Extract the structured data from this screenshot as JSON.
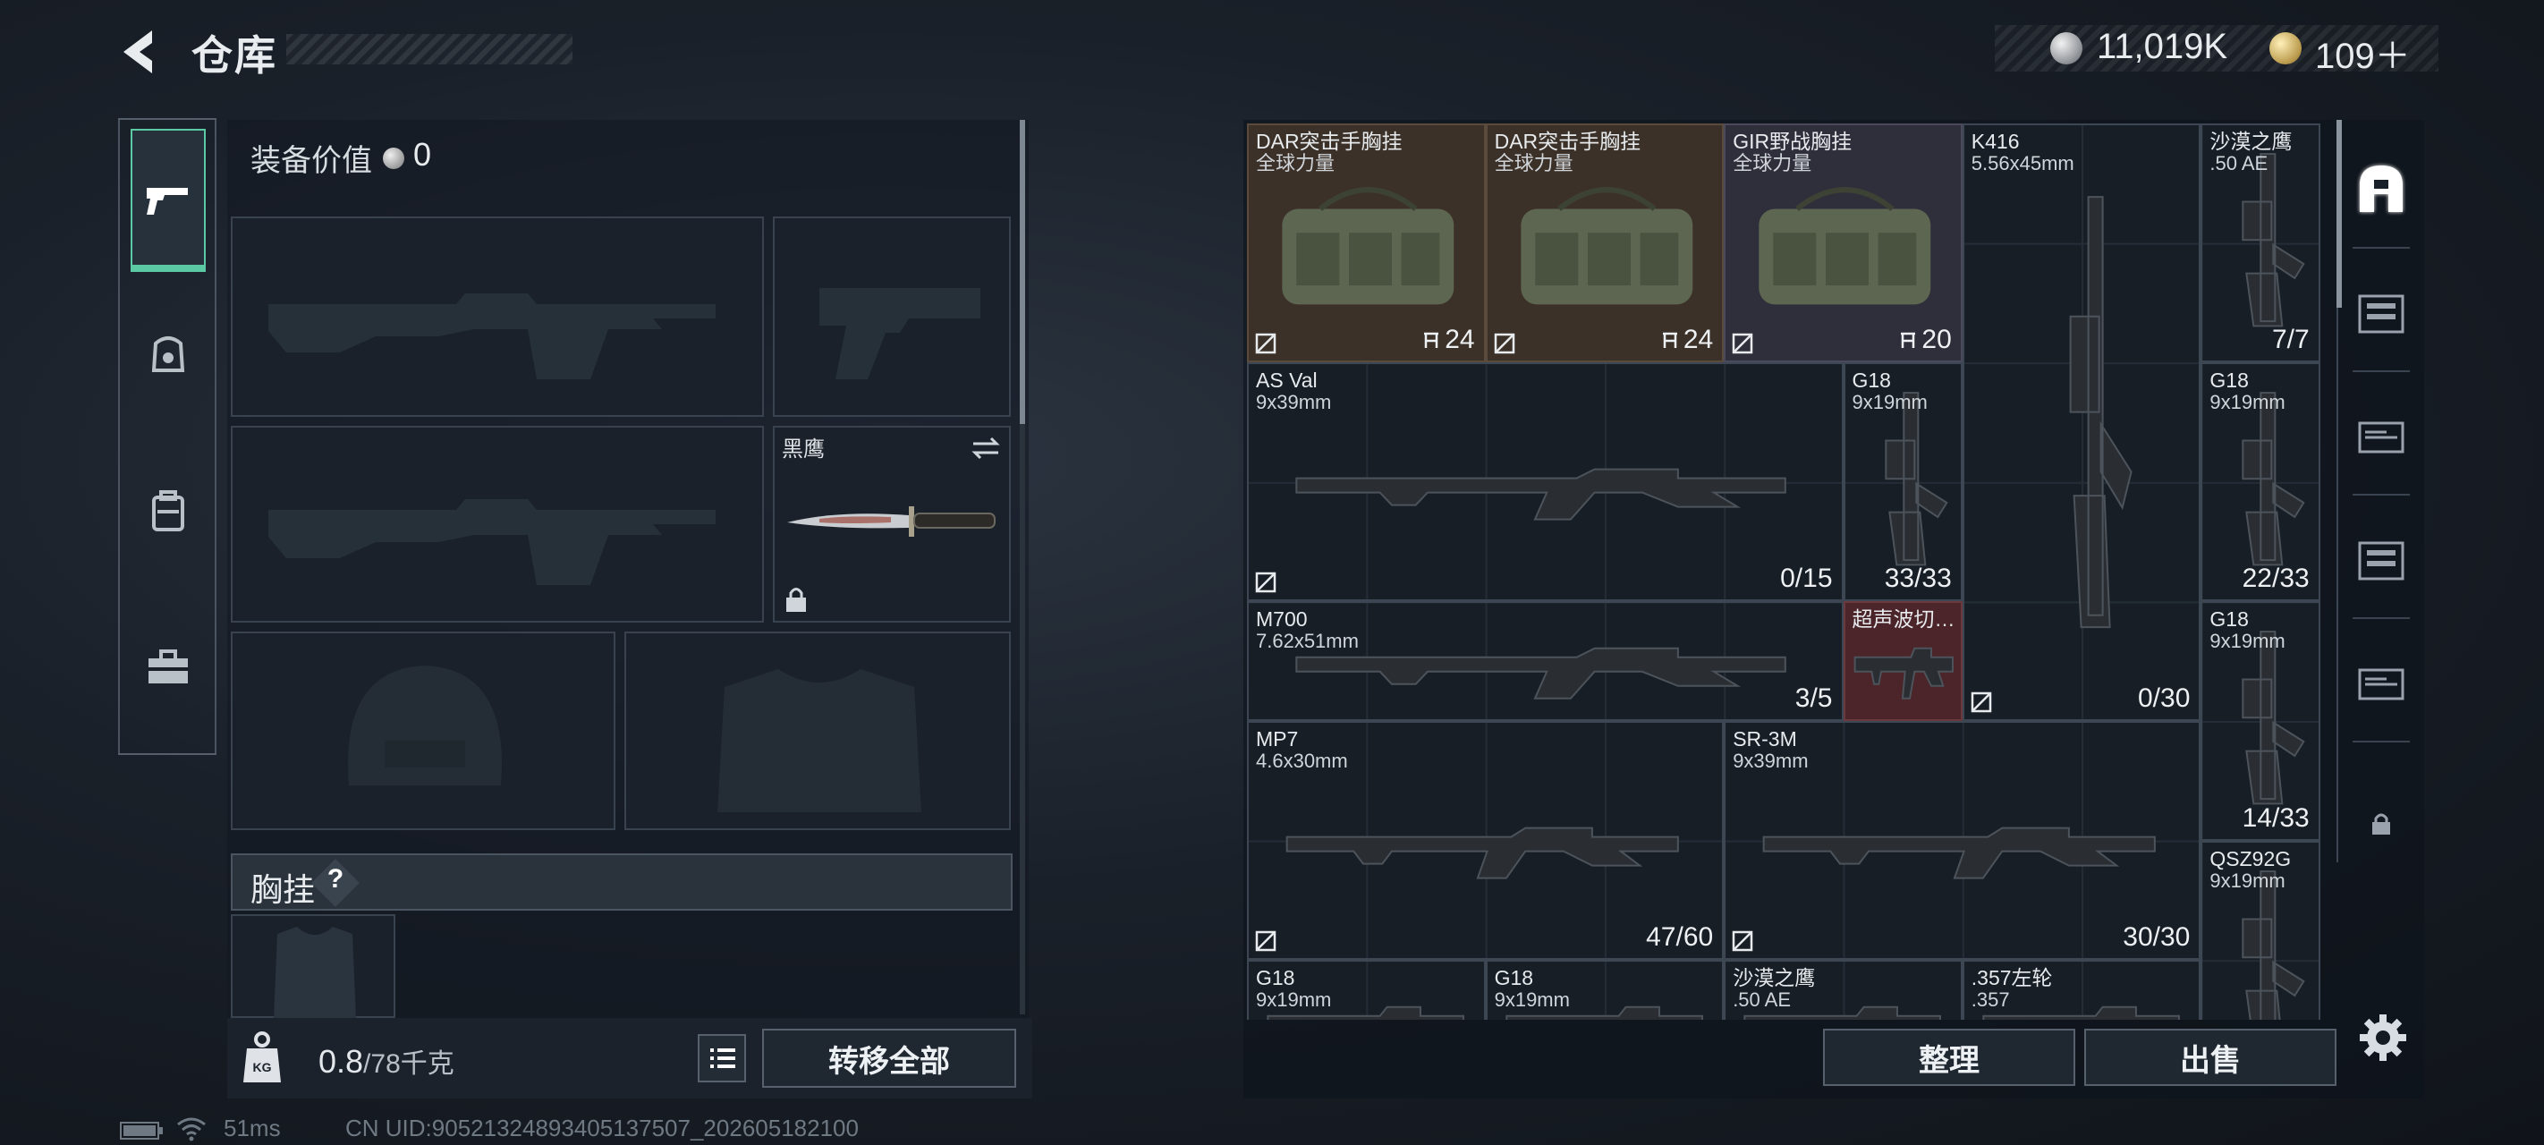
{
  "header": {
    "title": "仓库"
  },
  "currency": {
    "coins": "11,019K",
    "premium": "109＋"
  },
  "equipment": {
    "value_label": "装备价值",
    "value": "0",
    "melee_name": "黑鹰",
    "chest_label": "胸挂",
    "help_glyph": "?"
  },
  "storage": {
    "weight": "0.8",
    "max": "/78千克",
    "transfer_all": "转移全部"
  },
  "status": {
    "ping": "51ms",
    "uid": "CN UID:90521324893405137507_202605182100"
  },
  "warehouse": {
    "items": [
      {
        "name": "DAR突击手胸挂",
        "sub": "全球力量",
        "count": "24",
        "kind": "bag"
      },
      {
        "name": "DAR突击手胸挂",
        "sub": "全球力量",
        "count": "24",
        "kind": "bag"
      },
      {
        "name": "GIR野战胸挂",
        "sub": "全球力量",
        "count": "20",
        "kind": "bag"
      },
      {
        "name": "K416",
        "sub": "5.56x45mm",
        "count": "0/30"
      },
      {
        "name": "沙漠之鹰",
        "sub": ".50 AE",
        "count": "7/7"
      },
      {
        "name": "AS Val",
        "sub": "9x39mm",
        "count": "0/15"
      },
      {
        "name": "G18",
        "sub": "9x19mm",
        "count": "33/33"
      },
      {
        "name": "G18",
        "sub": "9x19mm",
        "count": "22/33"
      },
      {
        "name": "M700",
        "sub": "7.62x51mm",
        "count": "3/5"
      },
      {
        "name": "超声波切…",
        "sub": "",
        "count": ""
      },
      {
        "name": "G18",
        "sub": "9x19mm",
        "count": "14/33"
      },
      {
        "name": "MP7",
        "sub": "4.6x30mm",
        "count": "47/60"
      },
      {
        "name": "SR-3M",
        "sub": "9x39mm",
        "count": "30/30"
      },
      {
        "name": "QSZ92G",
        "sub": "9x19mm",
        "count": ""
      },
      {
        "name": "G18",
        "sub": "9x19mm",
        "count": ""
      },
      {
        "name": "G18",
        "sub": "9x19mm",
        "count": ""
      },
      {
        "name": "沙漠之鹰",
        "sub": ".50 AE",
        "count": ""
      },
      {
        "name": ".357左轮",
        "sub": ".357",
        "count": ""
      }
    ],
    "arrange": "整理",
    "sell": "出售"
  },
  "colors": {
    "accent": "#5bc9a3",
    "brown_cell": "#3c3128",
    "red_cell": "#4b2529"
  }
}
